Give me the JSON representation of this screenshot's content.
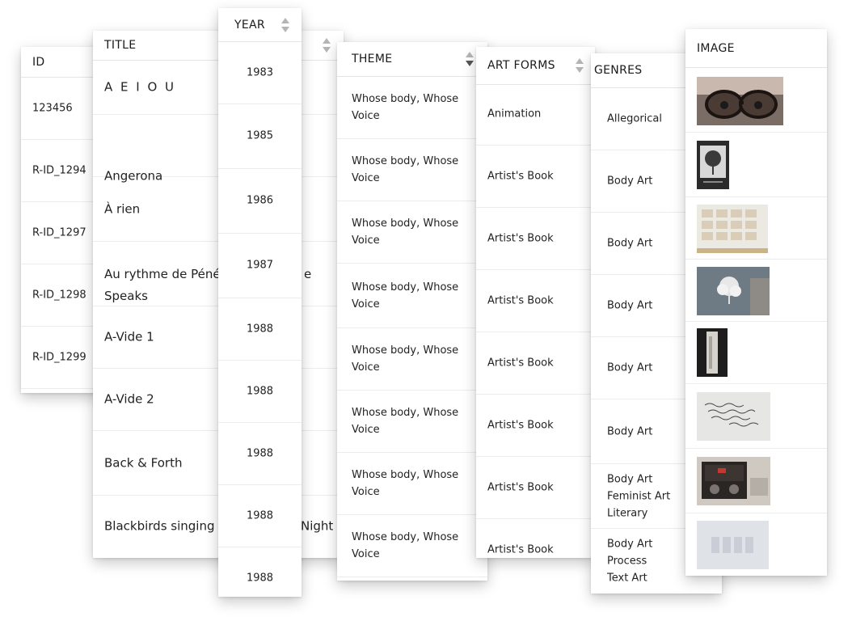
{
  "columns": {
    "id": "ID",
    "title": "TITLE",
    "year": "YEAR",
    "theme": "THEME",
    "art_forms": "ART FORMS",
    "genres": "GENRES",
    "image": "IMAGE"
  },
  "ids": [
    "123456",
    "R-ID_1294",
    "R-ID_1297",
    "R-ID_1298",
    "R-ID_1299"
  ],
  "titles": [
    "A E I O U",
    "Angerona",
    "À rien",
    "Au rythme de Pénél",
    "e",
    "Speaks",
    "A-Vide 1",
    "A-Vide 2",
    "Back & Forth",
    "Blackbirds singing i",
    "Night"
  ],
  "years": [
    "1983",
    "1985",
    "1986",
    "1987",
    "1988",
    "1988",
    "1988",
    "1988",
    "1988"
  ],
  "themes": [
    [
      "Whose body, Whose",
      "Voice"
    ],
    [
      "Whose body, Whose",
      "Voice"
    ],
    [
      "Whose body, Whose",
      "Voice"
    ],
    [
      "Whose body, Whose",
      "Voice"
    ],
    [
      "Whose body, Whose",
      "Voice"
    ],
    [
      "Whose body, Whose",
      "Voice"
    ],
    [
      "Whose body, Whose",
      "Voice"
    ],
    [
      "Whose body, Whose",
      "Voice"
    ]
  ],
  "art_forms": [
    "Animation",
    "Artist's Book",
    "Artist's Book",
    "Artist's Book",
    "Artist's Book",
    "Artist's Book",
    "Artist's Book",
    "Artist's Book"
  ],
  "genres": [
    [
      "Allegorical"
    ],
    [
      "Body Art"
    ],
    [
      "Body Art"
    ],
    [
      "Body Art"
    ],
    [
      "Body Art"
    ],
    [
      "Body Art"
    ],
    [
      "Body Art",
      "Feminist Art",
      "Literary"
    ],
    [
      "Body Art",
      "Process",
      "Text Art"
    ]
  ],
  "image_icons": [
    "photo-glasses-face",
    "photo-tree-print",
    "photo-paper-grid",
    "photo-white-tree",
    "photo-sculpture",
    "photo-handwriting",
    "photo-machine",
    "photo-faded-text"
  ],
  "colors": {
    "border": "#e4e4e4",
    "sort_arrow": "#b5b5b5",
    "text": "#222222"
  }
}
